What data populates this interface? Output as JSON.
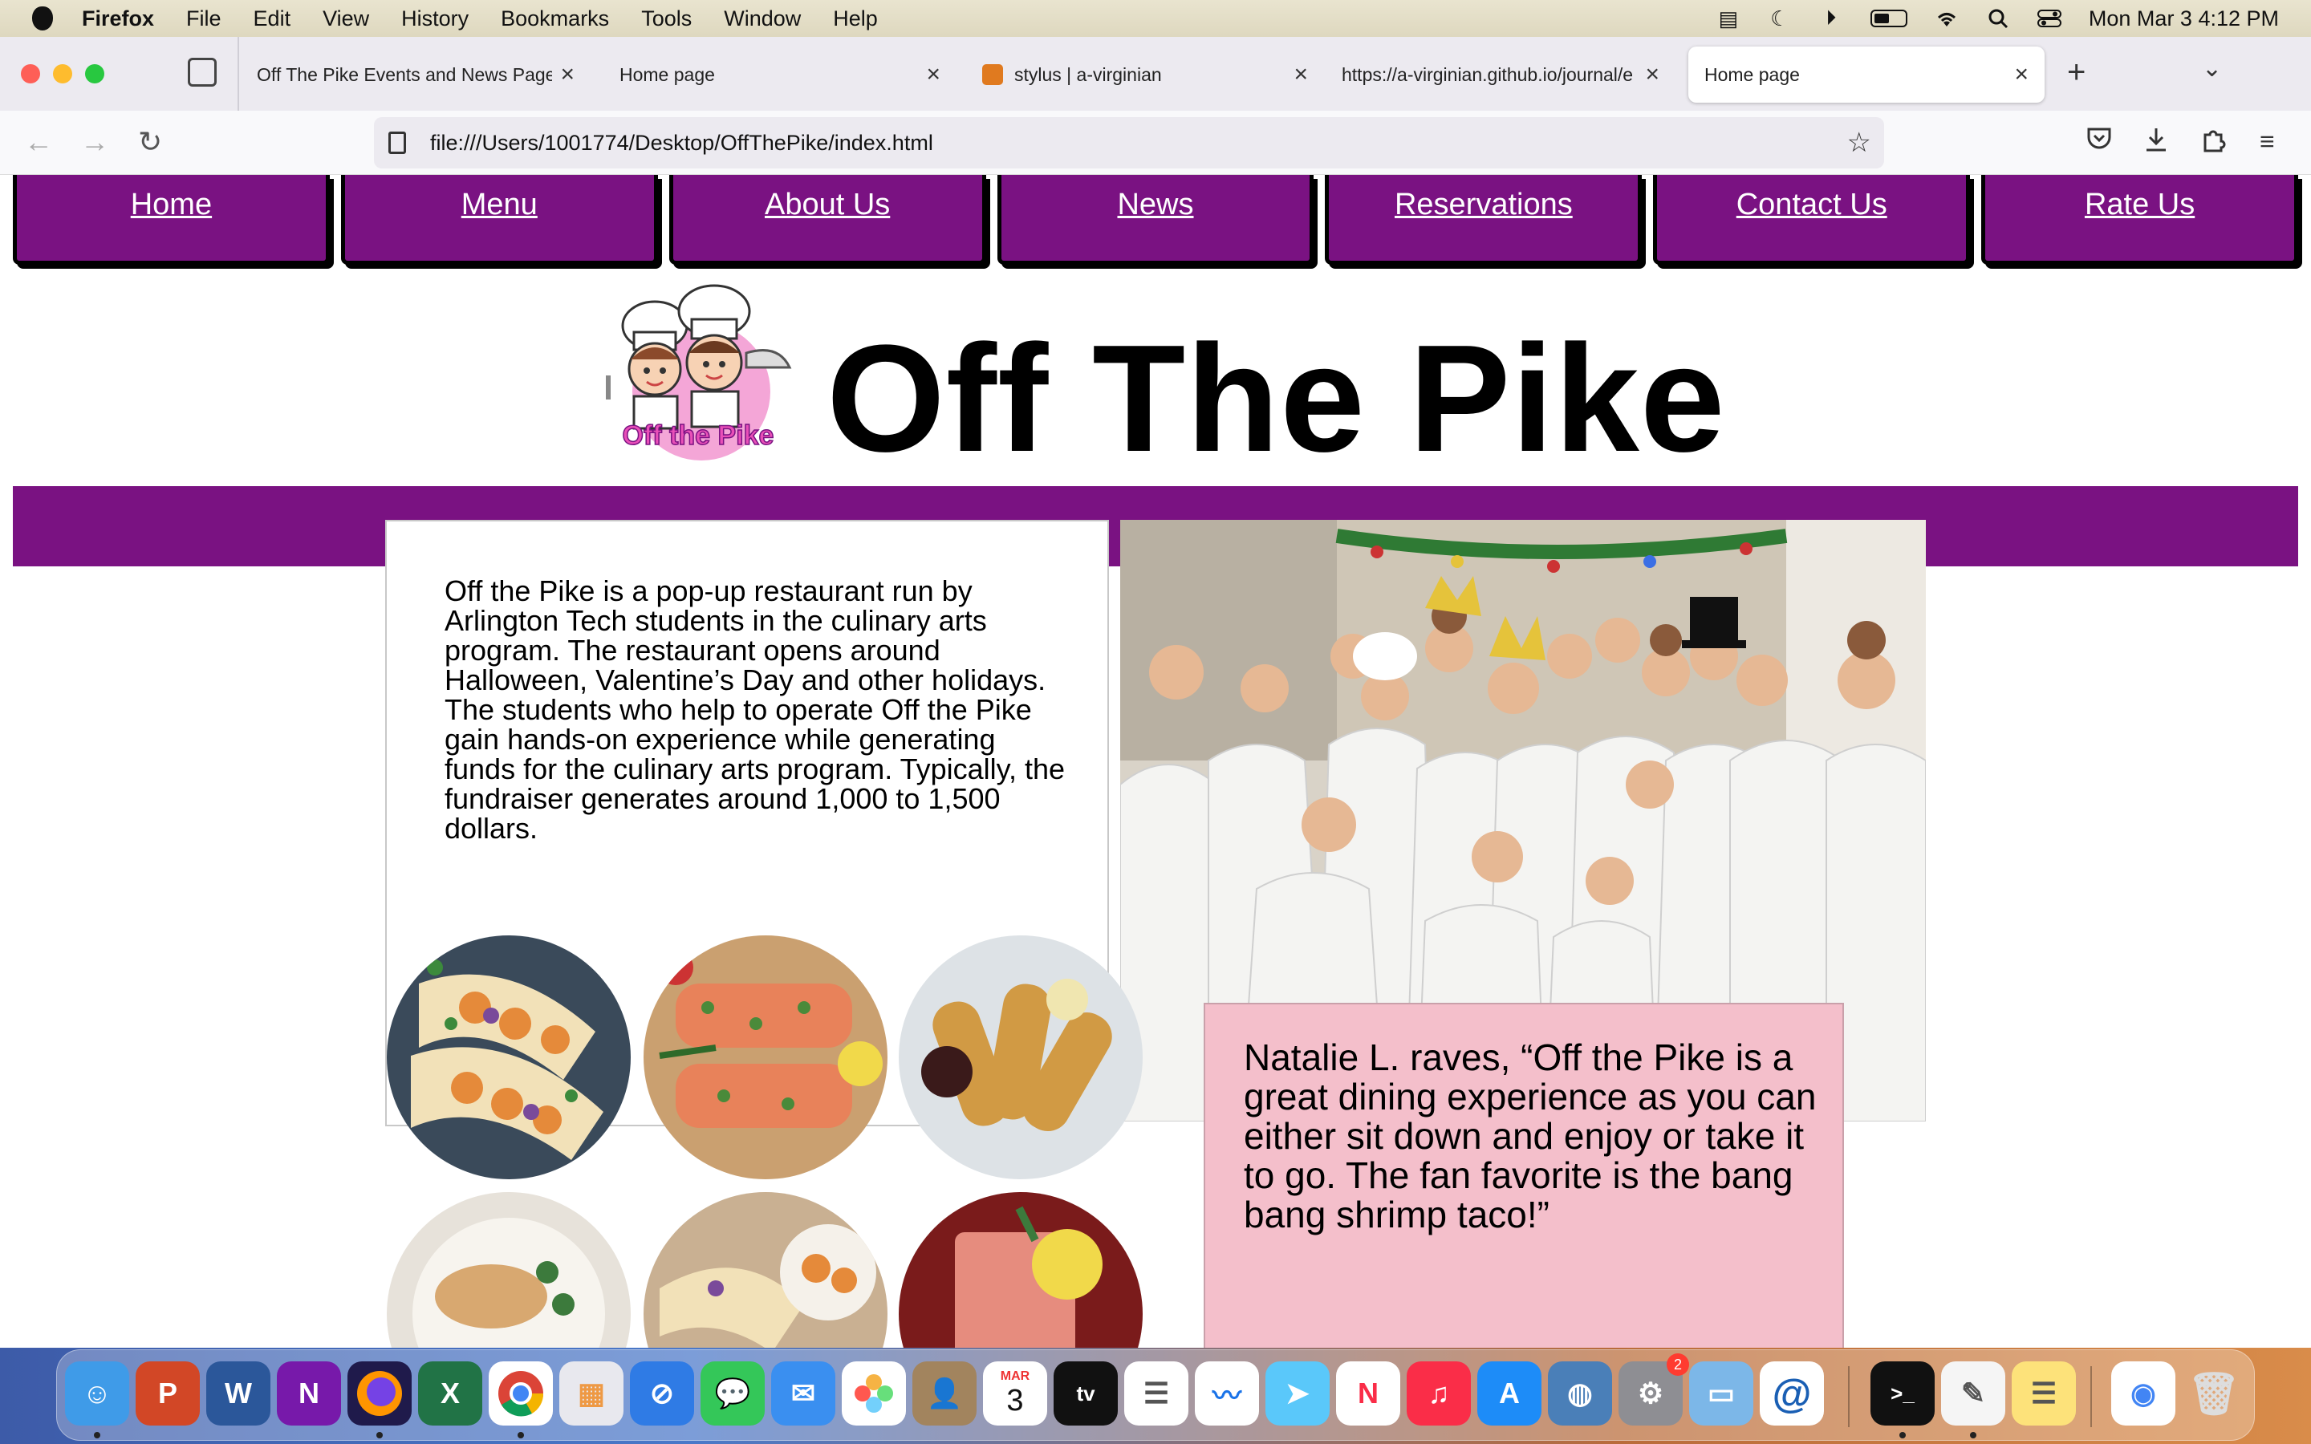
{
  "menubar": {
    "app_name": "Firefox",
    "menus": [
      "File",
      "Edit",
      "View",
      "History",
      "Bookmarks",
      "Tools",
      "Window",
      "Help"
    ],
    "datetime": "Mon Mar 3  4:12 PM"
  },
  "tabs": [
    {
      "title": "Off The Pike Events and News Page.",
      "active": false
    },
    {
      "title": "Home page",
      "active": false
    },
    {
      "title": "stylus | a-virginian",
      "active": false
    },
    {
      "title": "https://a-virginian.github.io/journal/e",
      "active": false
    },
    {
      "title": "Home page",
      "active": true
    }
  ],
  "address_bar": {
    "url": "file:///Users/1001774/Desktop/OffThePike/index.html"
  },
  "site": {
    "nav": [
      "Home",
      "Menu",
      "About Us",
      "News",
      "Reservations",
      "Contact Us",
      "Rate Us"
    ],
    "title": "Off The Pike",
    "logo_text": "Off the Pike",
    "about": "Off the Pike is a pop-up restaurant run by Arlington Tech students in the culinary arts program. The restaurant opens around Halloween, Valentine’s Day and other holidays. The students who help to operate Off the Pike gain hands-on experience while generating funds for the culinary arts program. Typically, the fundraiser generates around 1,000 to 1,500 dollars.",
    "quote": "Natalie L. raves, “Off the Pike is a great dining experience as you can either sit down and enjoy or take it to go. The fan favorite is the bang bang shrimp taco!”",
    "colors": {
      "nav_purple": "#7a1282",
      "quote_pink": "#f4bfcb"
    }
  },
  "dock": {
    "calendar_month": "MAR",
    "calendar_day": "3",
    "system_settings_badge": "2"
  }
}
